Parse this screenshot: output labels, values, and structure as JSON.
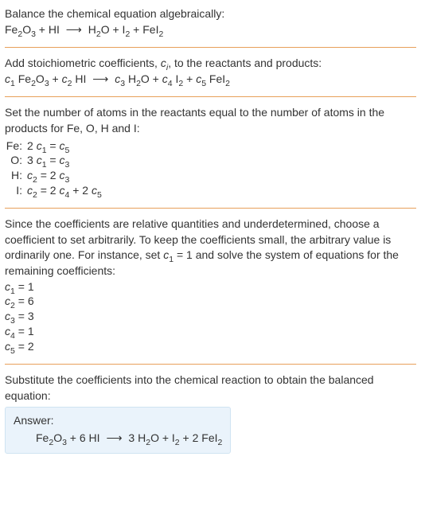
{
  "intro": {
    "line1": "Balance the chemical equation algebraically:"
  },
  "step2": {
    "line1_a": "Add stoichiometric coefficients, ",
    "line1_c": ", to the reactants and products:"
  },
  "step3": {
    "line1": "Set the number of atoms in the reactants equal to the number of atoms in the products for Fe, O, H and I:",
    "rows": {
      "fe_label": "Fe:",
      "o_label": "O:",
      "h_label": "H:",
      "i_label": "I:"
    }
  },
  "step4": {
    "text_a": "Since the coefficients are relative quantities and underdetermined, choose a coefficient to set arbitrarily. To keep the coefficients small, the arbitrary value is ordinarily one. For instance, set ",
    "text_b": " and solve the system of equations for the remaining coefficients:"
  },
  "step5": {
    "line1": "Substitute the coefficients into the chemical reaction to obtain the balanced equation:"
  },
  "answer": {
    "title": "Answer:"
  },
  "chart_data": {
    "type": "table",
    "title": "Balancing chemical equation Fe2O3 + HI -> H2O + I2 + FeI2",
    "unbalanced_reaction": {
      "reactants": [
        "Fe2O3",
        "HI"
      ],
      "products": [
        "H2O",
        "I2",
        "FeI2"
      ]
    },
    "coefficient_form": "c1 Fe2O3 + c2 HI -> c3 H2O + c4 I2 + c5 FeI2",
    "atom_balance_equations": [
      {
        "element": "Fe",
        "equation": "2 c1 = c5"
      },
      {
        "element": "O",
        "equation": "3 c1 = c3"
      },
      {
        "element": "H",
        "equation": "c2 = 2 c3"
      },
      {
        "element": "I",
        "equation": "c2 = 2 c4 + 2 c5"
      }
    ],
    "set_arbitrary": "c1 = 1",
    "solved_coefficients": {
      "c1": 1,
      "c2": 6,
      "c3": 3,
      "c4": 1,
      "c5": 2
    },
    "balanced_reaction": "Fe2O3 + 6 HI -> 3 H2O + I2 + 2 FeI2"
  }
}
